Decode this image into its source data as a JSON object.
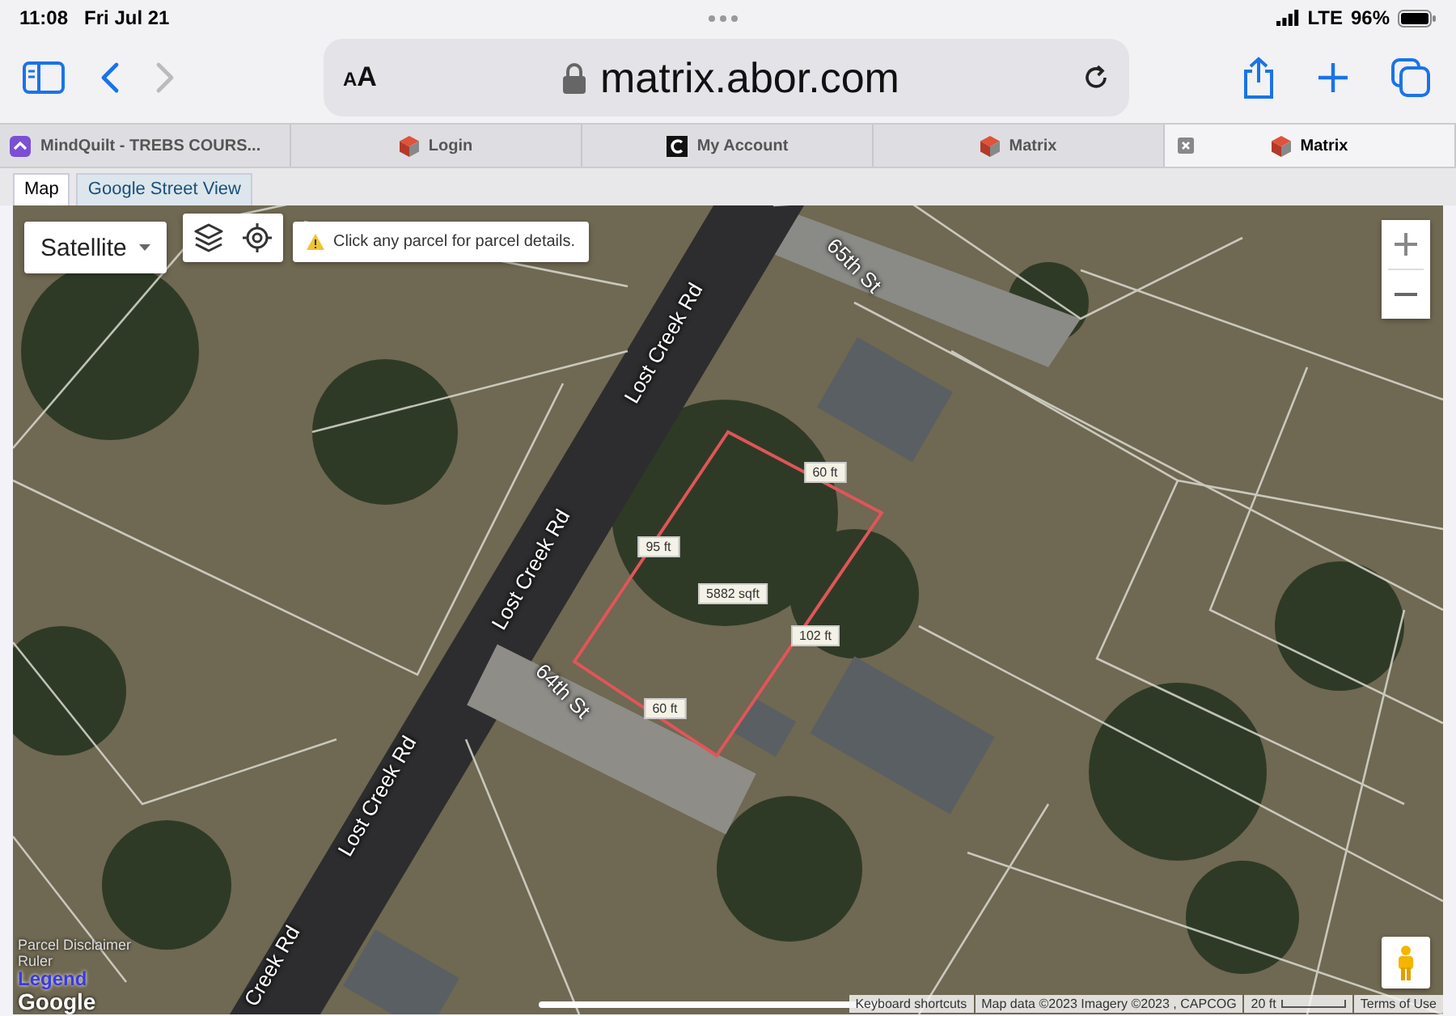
{
  "status_bar": {
    "time": "11:08",
    "date": "Fri Jul 21",
    "network": "LTE",
    "battery": "96%"
  },
  "toolbar": {
    "text_size": "AA",
    "url": "matrix.abor.com"
  },
  "tabs": [
    {
      "title": "MindQuilt - TREBS COURS...",
      "kind": "mindquilt",
      "selected": false
    },
    {
      "title": "Login",
      "kind": "matrix",
      "selected": false
    },
    {
      "title": "My Account",
      "kind": "letter",
      "selected": false
    },
    {
      "title": "Matrix",
      "kind": "matrix",
      "selected": false
    },
    {
      "title": "Matrix",
      "kind": "matrix",
      "selected": true
    }
  ],
  "map_tabs": [
    {
      "label": "Map",
      "selected": true
    },
    {
      "label": "Google Street View",
      "selected": false
    }
  ],
  "map": {
    "map_type": "Satellite",
    "notice": "Click any parcel for parcel details.",
    "street_labels": [
      "Lost Creek Rd",
      "Lost Creek Rd",
      "Lost Creek Rd",
      "Creek Rd",
      "65th St",
      "64th St"
    ],
    "parcel_measurements": [
      "60 ft",
      "95 ft",
      "5882 sqft",
      "102 ft",
      "60 ft"
    ],
    "links": [
      "Parcel Disclaimer",
      "Ruler",
      "Legend"
    ],
    "logo": "Google",
    "attribution": [
      "Keyboard shortcuts",
      "Map data ©2023 Imagery ©2023 , CAPCOG",
      "20 ft",
      "Terms of Use"
    ]
  }
}
